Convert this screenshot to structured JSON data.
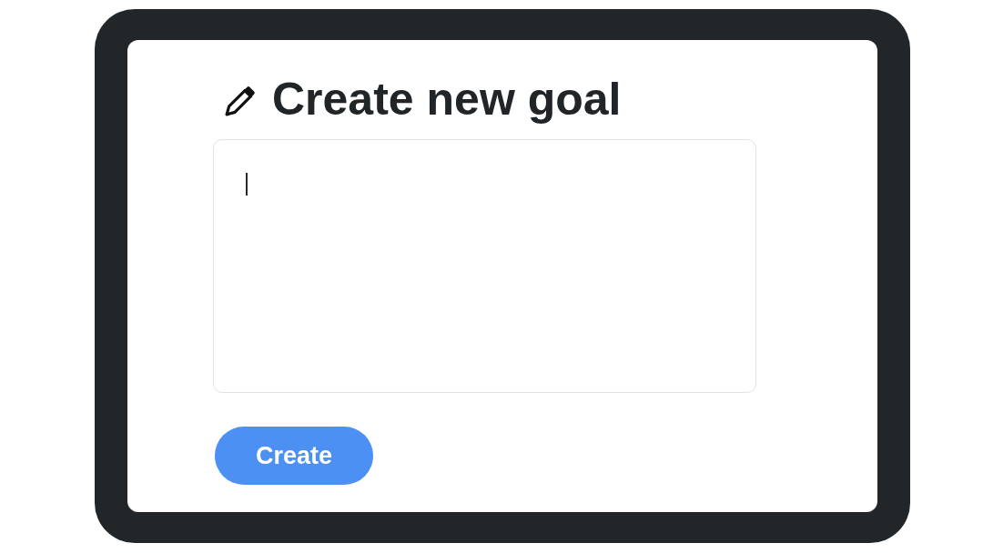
{
  "form": {
    "title": "Create new goal",
    "goal_input": {
      "focused": true
    },
    "button": {
      "label": "Create"
    }
  }
}
